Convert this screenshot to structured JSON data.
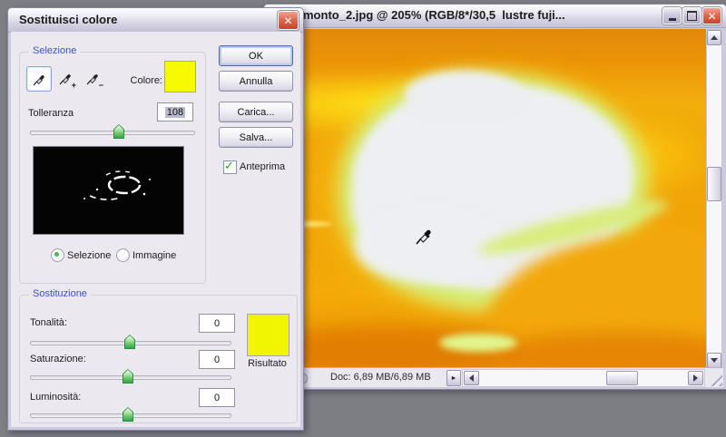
{
  "dialog": {
    "title": "Sostituisci colore",
    "selection": {
      "label": "Selezione",
      "color_label": "Colore:",
      "tolerance_label": "Tolleranza",
      "tolerance_value": "108",
      "radio_selection": "Selezione",
      "radio_image": "Immagine"
    },
    "replacement": {
      "label": "Sostituzione",
      "hue_label": "Tonalità:",
      "hue_value": "0",
      "saturation_label": "Saturazione:",
      "saturation_value": "0",
      "lightness_label": "Luminosità:",
      "lightness_value": "0",
      "result_label": "Risultato"
    },
    "buttons": {
      "ok": "OK",
      "cancel": "Annulla",
      "load": "Carica...",
      "save": "Salva..."
    },
    "preview_label": "Anteprima",
    "colors": {
      "selected_color": "#f7fa02",
      "result_color": "#f1f500"
    }
  },
  "window": {
    "title": "monto_2.jpg @ 205% (RGB/8*/30,5  lustre fuji...",
    "doc_info": "Doc: 6,89 MB/6,89 MB"
  },
  "icons": {
    "close": "✕",
    "check": "✓",
    "status_menu_arrow": "►",
    "plus": "+",
    "minus": "−"
  }
}
